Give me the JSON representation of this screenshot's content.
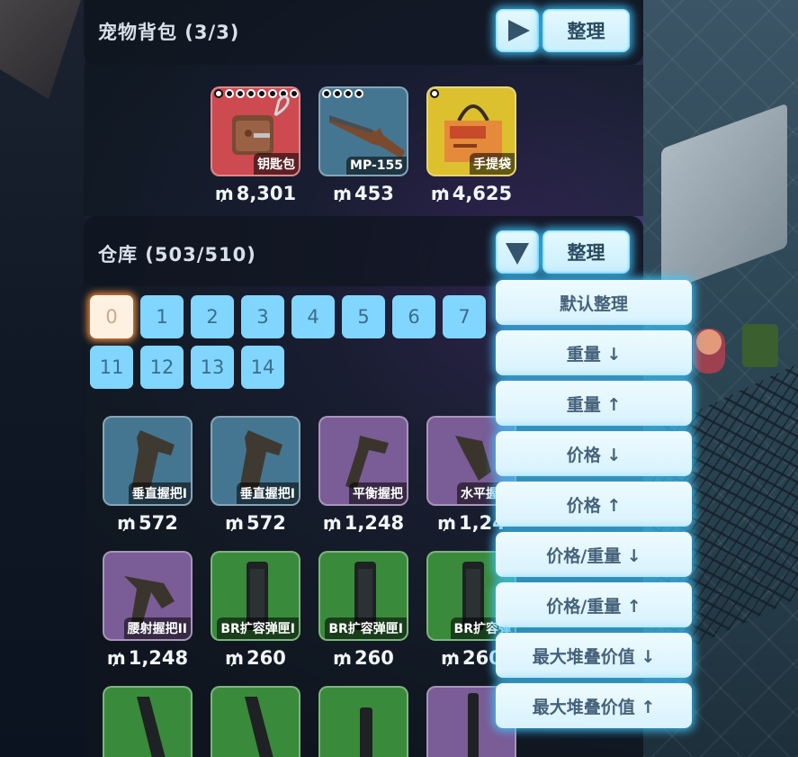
{
  "pet_bag": {
    "title": "宠物背包 (3/3)",
    "sort_label": "整理",
    "items": [
      {
        "label": "钥匙包",
        "price": "8,301"
      },
      {
        "label": "MP-155",
        "price": "453"
      },
      {
        "label": "手提袋",
        "price": "4,625"
      }
    ]
  },
  "currency_symbol": "₥",
  "warehouse": {
    "title": "仓库 (503/510)",
    "sort_label": "整理",
    "pages": [
      "0",
      "1",
      "2",
      "3",
      "4",
      "5",
      "6",
      "7",
      "11",
      "12",
      "13",
      "14"
    ],
    "active_page": "0",
    "items": [
      {
        "label": "垂直握把I",
        "price": "572",
        "color": "blue"
      },
      {
        "label": "垂直握把I",
        "price": "572",
        "color": "blue"
      },
      {
        "label": "平衡握把",
        "price": "1,248",
        "color": "purple"
      },
      {
        "label": "水平握把",
        "price": "1,24",
        "color": "purple"
      },
      {
        "label": "腰射握把II",
        "price": "1,248",
        "color": "purple"
      },
      {
        "label": "BR扩容弹匣I",
        "price": "260",
        "color": "green"
      },
      {
        "label": "BR扩容弹匣I",
        "price": "260",
        "color": "green"
      },
      {
        "label": "BR扩容弹",
        "price": "260",
        "color": "green"
      }
    ]
  },
  "sort_menu": {
    "options": [
      "默认整理",
      "重量 ↓",
      "重量 ↑",
      "价格 ↓",
      "价格 ↑",
      "价格/重量 ↓",
      "价格/重量 ↑",
      "最大堆叠价值 ↓",
      "最大堆叠价值 ↑"
    ]
  }
}
